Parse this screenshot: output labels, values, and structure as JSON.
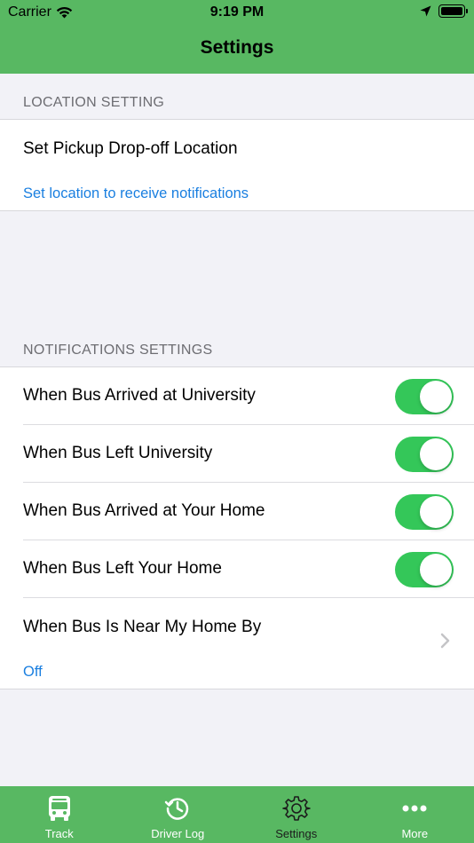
{
  "status_bar": {
    "carrier": "Carrier",
    "time": "9:19 PM"
  },
  "nav": {
    "title": "Settings"
  },
  "location_section": {
    "header": "LOCATION SETTING",
    "row_title": "Set Pickup Drop-off Location",
    "row_subtitle": "Set location to receive notifications"
  },
  "notifications_section": {
    "header": "NOTIFICATIONS SETTINGS",
    "toggles": [
      {
        "label": "When Bus Arrived at University",
        "on": true
      },
      {
        "label": "When Bus Left University",
        "on": true
      },
      {
        "label": "When Bus Arrived at Your Home",
        "on": true
      },
      {
        "label": "When Bus Left Your Home",
        "on": true
      }
    ],
    "near_home": {
      "label": "When Bus Is Near My Home By",
      "value": "Off"
    }
  },
  "tabbar": {
    "tabs": [
      {
        "label": "Track",
        "icon": "bus-icon"
      },
      {
        "label": "Driver Log",
        "icon": "history-icon"
      },
      {
        "label": "Settings",
        "icon": "gear-icon",
        "active": true
      },
      {
        "label": "More",
        "icon": "more-icon"
      }
    ]
  },
  "colors": {
    "header": "#58b862",
    "toggle_on": "#34c759",
    "link": "#1a7fe0"
  }
}
